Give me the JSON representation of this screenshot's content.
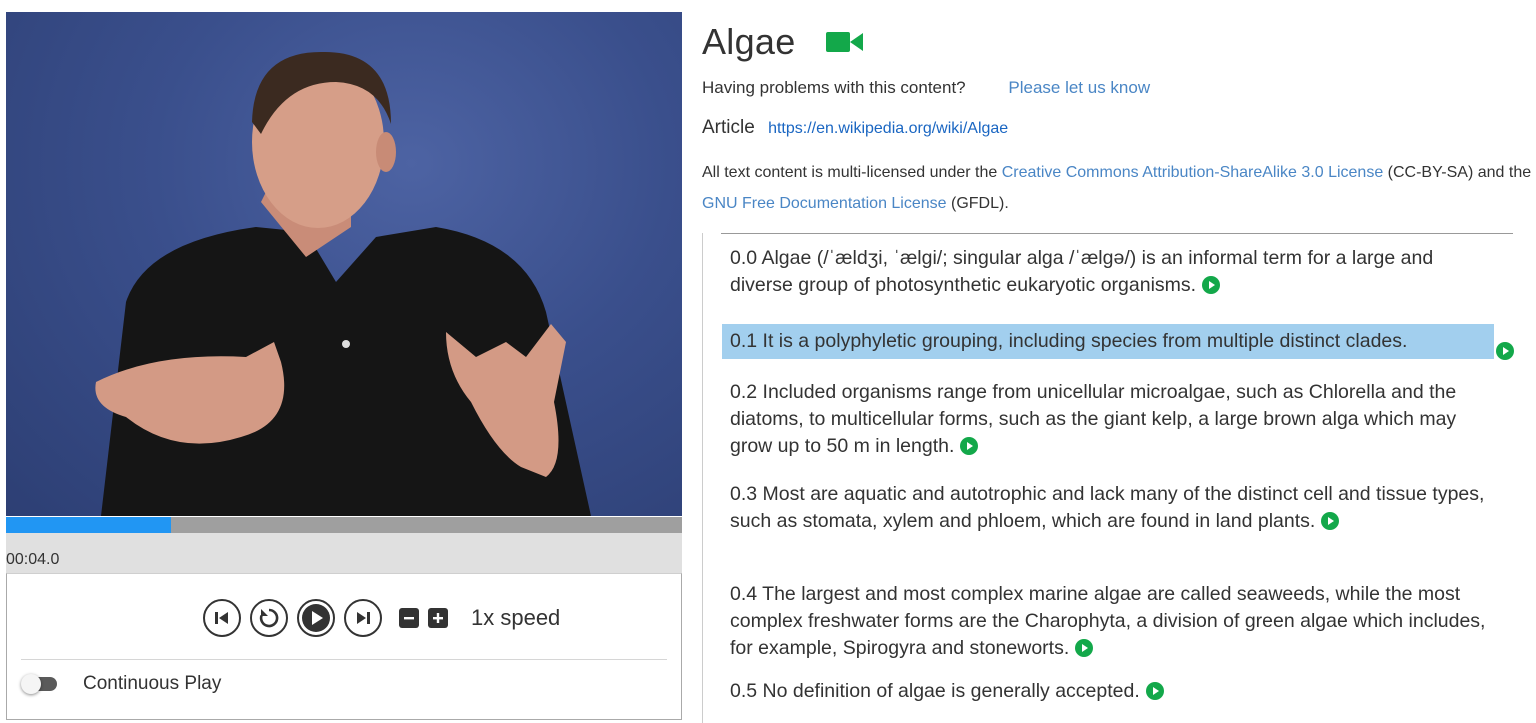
{
  "player": {
    "time": "00:04.0",
    "progress": 0.244,
    "speed_label": "1x speed",
    "continuous_play_label": "Continuous Play",
    "continuous_play_on": false,
    "accent_color": "#2196f3"
  },
  "page": {
    "title": "Algae",
    "title_icon": "video-camera-icon",
    "problems_text": "Having problems with this content?",
    "report_link": "Please let us know",
    "article_label": "Article",
    "article_url": "https://en.wikipedia.org/wiki/Algae",
    "license": {
      "text_1": "All text content is multi-licensed under the ",
      "link_cc": "Creative Commons Attribution-ShareAlike 3.0 License",
      "text_2": " (CC-BY-SA) and the ",
      "link_gnu": "GNU Free Documentation License",
      "text_3": " (GFDL)."
    }
  },
  "sentences": [
    {
      "text": "0.0 Algae (/ˈældʒi, ˈælɡi/; singular alga /ˈælɡə/) is an informal term for a large and diverse group of photosynthetic eukaryotic organisms.",
      "active": false
    },
    {
      "text": "0.1 It is a polyphyletic grouping, including species from multiple distinct clades.",
      "active": true
    },
    {
      "text": "0.2 Included organisms range from unicellular microalgae, such as Chlorella and the diatoms, to multicellular forms, such as the giant kelp, a large brown alga which may grow up to 50 m in length.",
      "active": false
    },
    {
      "text": "0.3 Most are aquatic and autotrophic and lack many of the distinct cell and tissue types, such as stomata, xylem and phloem, which are found in land plants.",
      "active": false
    },
    {
      "text": "0.4 The largest and most complex marine algae are called seaweeds, while the most complex freshwater forms are the Charophyta, a division of green algae which includes, for example, Spirogyra and stoneworts.",
      "active": false
    },
    {
      "text": "0.5 No definition of algae is generally accepted.",
      "active": false
    }
  ],
  "colors": {
    "highlight": "#a2cfee",
    "play_green": "#13a84a",
    "link_blue": "#4a86c5"
  }
}
